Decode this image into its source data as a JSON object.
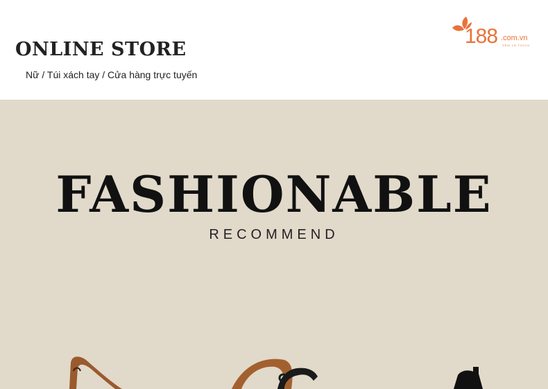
{
  "header": {
    "store_title": "ONLINE STORE",
    "breadcrumb": "Nữ / Túi xách tay / Cửa hàng trực tuyến"
  },
  "logo": {
    "number": "188",
    "domain": ".com.vn",
    "tagline": "SẼM LÀ THÍCH",
    "color": "#e8733b"
  },
  "banner": {
    "headline": "FASHIONABLE",
    "subheadline": "RECOMMEND",
    "background_color": "#e1d9ca"
  }
}
